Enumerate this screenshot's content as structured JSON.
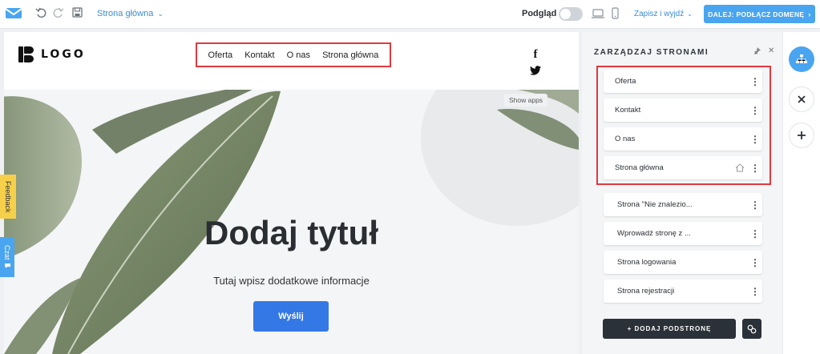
{
  "topbar": {
    "page_selector": "Strona główna",
    "preview_label": "Podgląd",
    "save_exit": "Zapisz i wyjdź",
    "next_button": "DALEJ: PODŁĄCZ DOMENĘ"
  },
  "site": {
    "logo_text": "LOGO",
    "nav": [
      "Oferta",
      "Kontakt",
      "O nas",
      "Strona główna"
    ],
    "show_apps": "Show apps",
    "hero_title": "Dodaj tytuł",
    "hero_subtitle": "Tutaj wpisz dodatkowe informacje",
    "hero_button": "Wyślij"
  },
  "side_tabs": {
    "feedback": "Feedback",
    "chat": "Czat"
  },
  "panel": {
    "title": "ZARZĄDZAJ STRONAMI",
    "pages": [
      {
        "label": "Oferta"
      },
      {
        "label": "Kontakt"
      },
      {
        "label": "O nas"
      },
      {
        "label": "Strona główna",
        "is_home": true
      },
      {
        "label": "Strona \"Nie znalezio..."
      },
      {
        "label": "Wprowadź stronę z ..."
      },
      {
        "label": "Strona logowania"
      },
      {
        "label": "Strona rejestracji"
      }
    ],
    "add_page_button": "+ DODAJ PODSTRONĘ"
  },
  "colors": {
    "accent_blue": "#49a5f0",
    "highlight_red": "#e0393f",
    "hero_button": "#3478e6",
    "dark_button": "#2b3138",
    "feedback_yellow": "#f6d04a"
  },
  "icons": [
    "mail-logo-icon",
    "undo-icon",
    "redo-icon",
    "save-icon",
    "chevron-down-icon",
    "desktop-icon",
    "mobile-icon",
    "facebook-icon",
    "twitter-icon",
    "pin-icon",
    "close-icon",
    "more-icon",
    "home-icon",
    "link-icon",
    "sitemap-icon",
    "plus-icon",
    "chat-icon"
  ]
}
